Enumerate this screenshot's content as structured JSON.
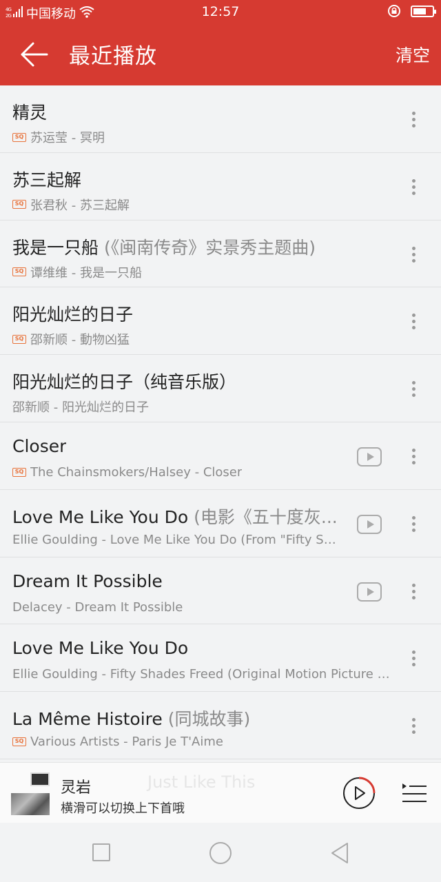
{
  "status_bar": {
    "signal": "4G 2G",
    "carrier": "中国移动",
    "time": "12:57"
  },
  "header": {
    "title": "最近播放",
    "clear_label": "清空"
  },
  "songs": [
    {
      "title": "精灵",
      "title_sub": "",
      "meta": "苏运莹 - 冥明",
      "sq": true,
      "mv": false
    },
    {
      "title": "苏三起解",
      "title_sub": "",
      "meta": "张君秋 - 苏三起解",
      "sq": true,
      "mv": false
    },
    {
      "title": "我是一只船",
      "title_sub": " (《闽南传奇》实景秀主题曲)",
      "meta": "谭维维 - 我是一只船",
      "sq": true,
      "mv": false
    },
    {
      "title": "阳光灿烂的日子",
      "title_sub": "",
      "meta": "邵新顺 - 動物凶猛",
      "sq": true,
      "mv": false
    },
    {
      "title": "阳光灿烂的日子（纯音乐版）",
      "title_sub": "",
      "meta": "邵新顺 - 阳光灿烂的日子",
      "sq": false,
      "mv": false
    },
    {
      "title": "Closer",
      "title_sub": "",
      "meta": "The Chainsmokers/Halsey - Closer",
      "sq": true,
      "mv": true
    },
    {
      "title": "Love Me Like You Do",
      "title_sub": " (电影《五十度灰...",
      "meta": "Ellie Goulding - Love Me Like You Do (From \"Fifty Sha...",
      "sq": false,
      "mv": true
    },
    {
      "title": "Dream It Possible",
      "title_sub": "",
      "meta": "Delacey - Dream It Possible",
      "sq": false,
      "mv": true
    },
    {
      "title": "Love Me Like You Do",
      "title_sub": "",
      "meta": "Ellie Goulding - Fifty Shades Freed (Original Motion Picture So...",
      "sq": false,
      "mv": false
    },
    {
      "title": "La Même Histoire",
      "title_sub": " (同城故事)",
      "meta": "Various Artists - Paris Je T'Aime",
      "sq": true,
      "mv": false
    }
  ],
  "sq_badge": "SQ",
  "player": {
    "title": "灵岩",
    "subtitle": "横滑可以切换上下首哦",
    "ghost_title": "Just Like This"
  },
  "icons": {
    "back": "arrow-left-icon",
    "more": "more-vertical-icon",
    "mv": "video-play-icon",
    "play": "play-circle-icon",
    "playlist": "playlist-icon"
  },
  "colors": {
    "brand": "#d63a31",
    "sq_badge": "#e8723a"
  }
}
